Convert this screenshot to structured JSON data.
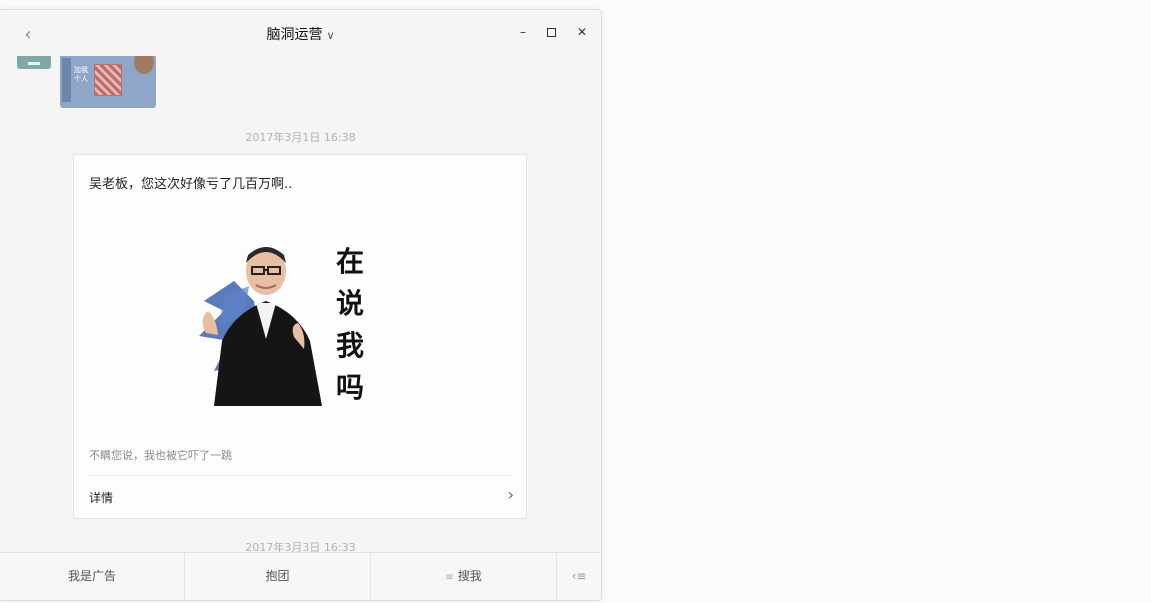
{
  "window": {
    "title": "脑洞运营",
    "back_icon": "chevron-left-icon",
    "controls": [
      "minimize-icon",
      "maximize-icon",
      "close-icon"
    ]
  },
  "messages": {
    "timestamp_1": "2017年3月1日 16:38",
    "timestamp_2": "2017年3月3日 16:33",
    "card": {
      "title": "吴老板，您这次好像亏了几百万啊..",
      "image_caption": [
        "在",
        "说",
        "我",
        "吗"
      ],
      "description": "不瞒您说，我也被它吓了一跳",
      "link_label": "详情"
    },
    "prev_image_text": "加我个人"
  },
  "menu": {
    "items": [
      "我是广告",
      "抱团",
      "搜我"
    ],
    "toggle_icon": "keyboard-switch-icon"
  },
  "colors": {
    "background": "#f5f5f5",
    "card_background": "#fdfdfd",
    "timestamp": "#b0b0b0"
  }
}
